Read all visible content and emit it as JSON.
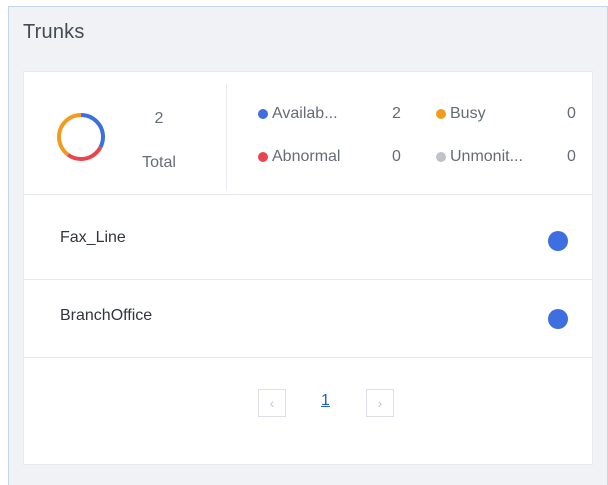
{
  "panel": {
    "title": "Trunks"
  },
  "summary": {
    "total_count": "2",
    "total_label": "Total",
    "stats": [
      {
        "label": "Availab...",
        "value": "2",
        "color": "#3d6fe0"
      },
      {
        "label": "Busy",
        "value": "0",
        "color": "#f29c1f"
      },
      {
        "label": "Abnormal",
        "value": "0",
        "color": "#e8464e"
      },
      {
        "label": "Unmonit...",
        "value": "0",
        "color": "#bfc3c9"
      }
    ]
  },
  "trunks": [
    {
      "name": "Fax_Line",
      "status_color": "#3d6fe0"
    },
    {
      "name": "BranchOffice",
      "status_color": "#3d6fe0"
    }
  ],
  "pagination": {
    "prev_icon": "chevron-left-icon",
    "next_icon": "chevron-right-icon",
    "prev_glyph": "‹",
    "next_glyph": "›",
    "current_page": "1"
  }
}
